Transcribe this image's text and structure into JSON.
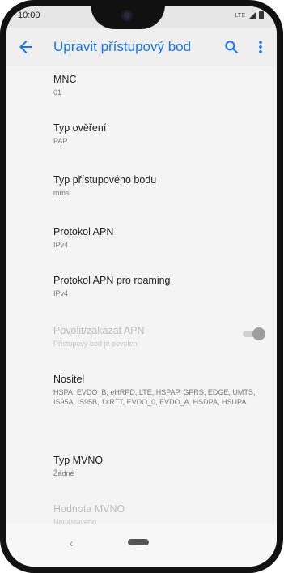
{
  "status_bar": {
    "time": "10:00",
    "network": "LTE"
  },
  "app_bar": {
    "title": "Upravit přístupový bod",
    "back_icon": "arrow-left-icon",
    "search_icon": "search-icon",
    "more_icon": "more-vert-icon"
  },
  "settings": [
    {
      "label": "MNC",
      "value": "01"
    },
    {
      "label": "Typ ověření",
      "value": "PAP"
    },
    {
      "label": "Typ přístupového bodu",
      "value": "mms"
    },
    {
      "label": "Protokol APN",
      "value": "IPv4"
    },
    {
      "label": "Protokol APN pro roaming",
      "value": "IPv4"
    },
    {
      "label": "Povolit/zakázat APN",
      "value": "Přístupový bod je povolen",
      "enabled": false,
      "toggle_on": true
    },
    {
      "label": "Nositel",
      "value": "HSPA, EVDO_B, eHRPD, LTE, HSPAP, GPRS, EDGE, UMTS, IS95A, IS95B, 1×RTT, EVDO_0, EVDO_A, HSDPA, HSUPA"
    },
    {
      "label": "Typ MVNO",
      "value": "Žádné"
    },
    {
      "label": "Hodnota MVNO",
      "value": "Nenastaveno",
      "enabled": false
    }
  ],
  "nav_bar": {
    "back_label": "‹",
    "home_icon": "home-pill-icon"
  },
  "colors": {
    "accent": "#1a73e8",
    "appbar": "#efefef",
    "background": "#f4f4f4"
  }
}
